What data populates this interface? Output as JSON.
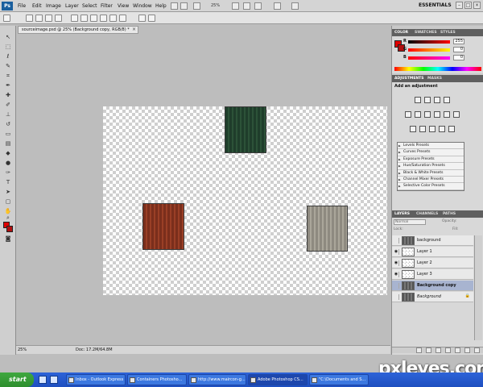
{
  "app": {
    "logo": "Ps",
    "menus": [
      "File",
      "Edit",
      "Image",
      "Layer",
      "Select",
      "Filter",
      "View",
      "Window",
      "Help"
    ],
    "zoom_display": "25%",
    "workspace": "ESSENTIALS",
    "window_controls": [
      "–",
      "□",
      "×"
    ]
  },
  "document": {
    "tab_title": "sourceimage.psd @ 25% (Background copy, RGB/8) *",
    "tab_close": "×"
  },
  "status": {
    "zoom": "25%",
    "doc_size": "Doc: 17.2M/64.8M"
  },
  "color_panel": {
    "tabs": [
      "COLOR",
      "SWATCHES",
      "STYLES"
    ],
    "channels": [
      {
        "label": "R",
        "value": "255"
      },
      {
        "label": "G",
        "value": "0"
      },
      {
        "label": "B",
        "value": "0"
      }
    ]
  },
  "adjustments_panel": {
    "tabs": [
      "ADJUSTMENTS",
      "MASKS"
    ],
    "title": "Add an adjustment",
    "presets": [
      "Levels Presets",
      "Curves Presets",
      "Exposure Presets",
      "Hue/Saturation Presets",
      "Black & White Presets",
      "Channel Mixer Presets",
      "Selective Color Presets"
    ]
  },
  "layers_panel": {
    "tabs": [
      "LAYERS",
      "CHANNELS",
      "PATHS"
    ],
    "blend_mode": "Normal",
    "opacity_label": "Opacity:",
    "fill_label": "Fill:",
    "lock_label": "Lock:",
    "layers": [
      {
        "name": "background",
        "visible": false,
        "thumb": "photo",
        "selected": false,
        "italic": false,
        "locked": false
      },
      {
        "name": "Layer 1",
        "visible": true,
        "thumb": "checker",
        "selected": false,
        "italic": false,
        "locked": false
      },
      {
        "name": "Layer 2",
        "visible": true,
        "thumb": "checker",
        "selected": false,
        "italic": false,
        "locked": false
      },
      {
        "name": "Layer 3",
        "visible": true,
        "thumb": "checker",
        "selected": false,
        "italic": false,
        "locked": false
      },
      {
        "name": "Background copy",
        "visible": false,
        "thumb": "photo",
        "selected": true,
        "italic": false,
        "locked": false
      },
      {
        "name": "Background",
        "visible": false,
        "thumb": "photo",
        "selected": false,
        "italic": true,
        "locked": true
      }
    ]
  },
  "taskbar": {
    "start_label": "start",
    "items": [
      {
        "label": "Inbox - Outlook Express",
        "active": false
      },
      {
        "label": "Containers Photosho...",
        "active": false
      },
      {
        "label": "http://www.maircon-g...",
        "active": false
      },
      {
        "label": "Adobe Photoshop CS...",
        "active": true
      },
      {
        "label": "\"C:\\Documents and S...",
        "active": false
      }
    ]
  },
  "watermark": "pxleyes.com"
}
